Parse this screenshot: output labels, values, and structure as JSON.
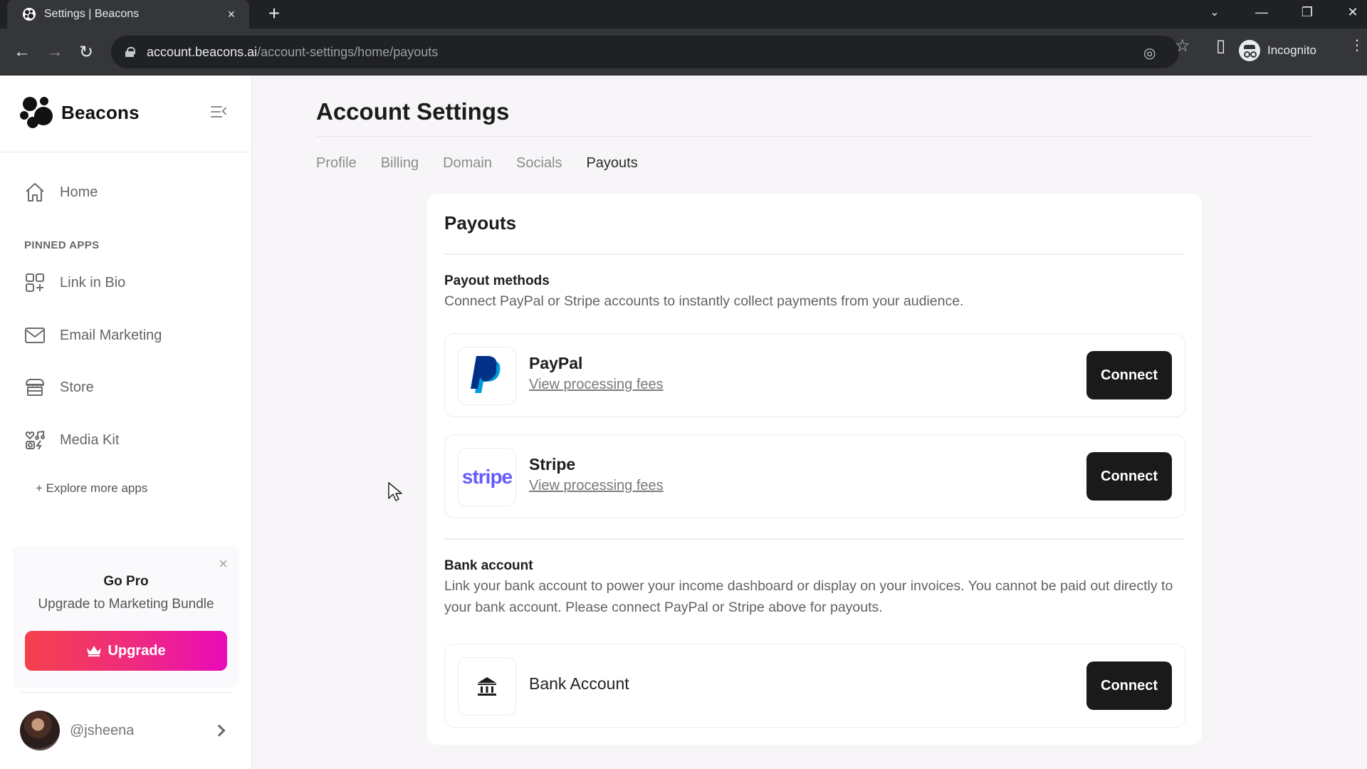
{
  "browser": {
    "tab_title": "Settings | Beacons",
    "tab_close": "×",
    "new_tab": "+",
    "url_host": "account.beacons.ai",
    "url_path": "/account-settings/home/payouts",
    "profile_label": "Incognito",
    "window_controls": {
      "tab_search": "⌄",
      "minimize": "—",
      "restore": "❐",
      "close": "✕"
    },
    "nav": {
      "back": "←",
      "forward": "→",
      "reload": "↻"
    },
    "omnibox_icons": {
      "tracking_off": "◎",
      "bookmark": "☆",
      "side_panel": "▯"
    },
    "menu": "⋮"
  },
  "sidebar": {
    "brand": "Beacons",
    "home": "Home",
    "pinned_label": "PINNED APPS",
    "items": [
      {
        "label": "Link in Bio",
        "icon": "apps-add-icon"
      },
      {
        "label": "Email Marketing",
        "icon": "envelope-icon"
      },
      {
        "label": "Store",
        "icon": "storefront-icon"
      },
      {
        "label": "Media Kit",
        "icon": "media-kit-icon"
      }
    ],
    "explore": "+ Explore more apps",
    "promo": {
      "title": "Go Pro",
      "subtitle": "Upgrade to Marketing Bundle",
      "button": "Upgrade",
      "close": "×",
      "gradient": [
        "#f4414c",
        "#ea0ab8"
      ]
    },
    "user": {
      "handle": "@jsheena"
    }
  },
  "main": {
    "title": "Account Settings",
    "tabs": [
      {
        "label": "Profile",
        "active": false
      },
      {
        "label": "Billing",
        "active": false
      },
      {
        "label": "Domain",
        "active": false
      },
      {
        "label": "Socials",
        "active": false
      },
      {
        "label": "Payouts",
        "active": true
      }
    ],
    "card": {
      "title": "Payouts",
      "payout_methods": {
        "title": "Payout methods",
        "description": "Connect PayPal or Stripe accounts to instantly collect payments from your audience.",
        "methods": [
          {
            "name": "PayPal",
            "link": "View processing fees",
            "button": "Connect",
            "colors": [
              "#003087",
              "#009cde"
            ]
          },
          {
            "name": "Stripe",
            "logo_text": "stripe",
            "link": "View processing fees",
            "button": "Connect",
            "color": "#635bff"
          }
        ]
      },
      "bank": {
        "title": "Bank account",
        "description": "Link your bank account to power your income dashboard or display on your invoices. You cannot be paid out directly to your bank account. Please connect PayPal or Stripe above for payouts.",
        "name": "Bank Account",
        "button": "Connect"
      }
    }
  }
}
